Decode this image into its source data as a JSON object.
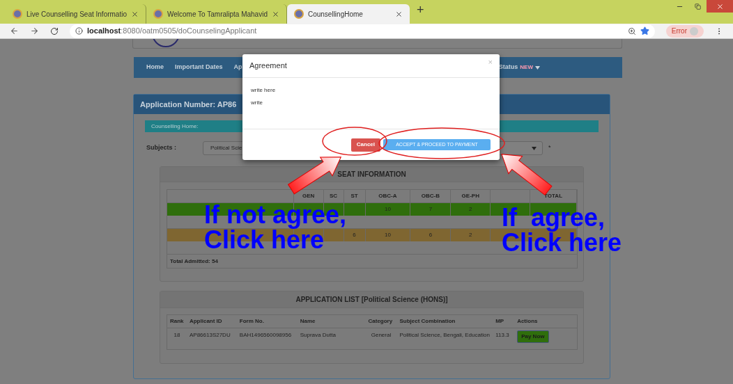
{
  "browser": {
    "tabs": [
      {
        "title": "Live Counselling Seat Informatio",
        "selected": false
      },
      {
        "title": "Welcome To Tamralipta Mahavid",
        "selected": false
      },
      {
        "title": "CounsellingHome",
        "selected": true
      }
    ],
    "new_tab": "+",
    "url": "**localhost**:8080/oatm0505/doCounselingApplicant",
    "profile_status": "Error"
  },
  "nav": {
    "items": [
      "Home",
      "Important Dates",
      "Ap"
    ],
    "status": {
      "label": "Status",
      "badge": "NEW"
    }
  },
  "panel": {
    "title": "Application Number: AP86",
    "section": "Counselling Home:",
    "subjects_label": "Subjects :",
    "subject_value": "Political Scie",
    "required_mark": "*"
  },
  "seat_info": {
    "title": "SEAT INFORMATION",
    "columns": [
      null,
      "GEN",
      "SC",
      "ST",
      "OBC-A",
      "OBC-B",
      "GE-PH",
      null,
      "TOTAL"
    ],
    "rows": [
      {
        "kind": "subject",
        "cells": [
          null,
          null,
          null,
          null,
          "10",
          "7",
          "2",
          null,
          null
        ]
      },
      {
        "kind": "vacancy",
        "cells": [
          null,
          null,
          null,
          "6",
          "10",
          "6",
          "2",
          null,
          null
        ]
      }
    ],
    "total": "Total Admitted: 54"
  },
  "application_list": {
    "title": "APPLICATION LIST [Political Science (HONS)]",
    "columns": [
      "Rank",
      "Applicant ID",
      "Form No.",
      "Name",
      "Category",
      "Subject Combination",
      "MP",
      "Actions"
    ],
    "rows": [
      {
        "cells": [
          "18",
          "AP86613S27DU",
          "BAH1496560098956",
          "Suprava Dutta",
          "General",
          "Political Science, Bengali, Education",
          "113.3"
        ],
        "action": "Pay Now"
      }
    ]
  },
  "modal": {
    "title": "Agreement",
    "close": "×",
    "lines": [
      "write here",
      "write"
    ],
    "cancel": "Cancel",
    "accept": "ACCEPT & PROCEED TO PAYMENT"
  },
  "annotations": [
    {
      "lines": [
        "If not agree,",
        "Click here"
      ]
    },
    {
      "lines": [
        "If  agree,",
        "Click here"
      ]
    }
  ]
}
